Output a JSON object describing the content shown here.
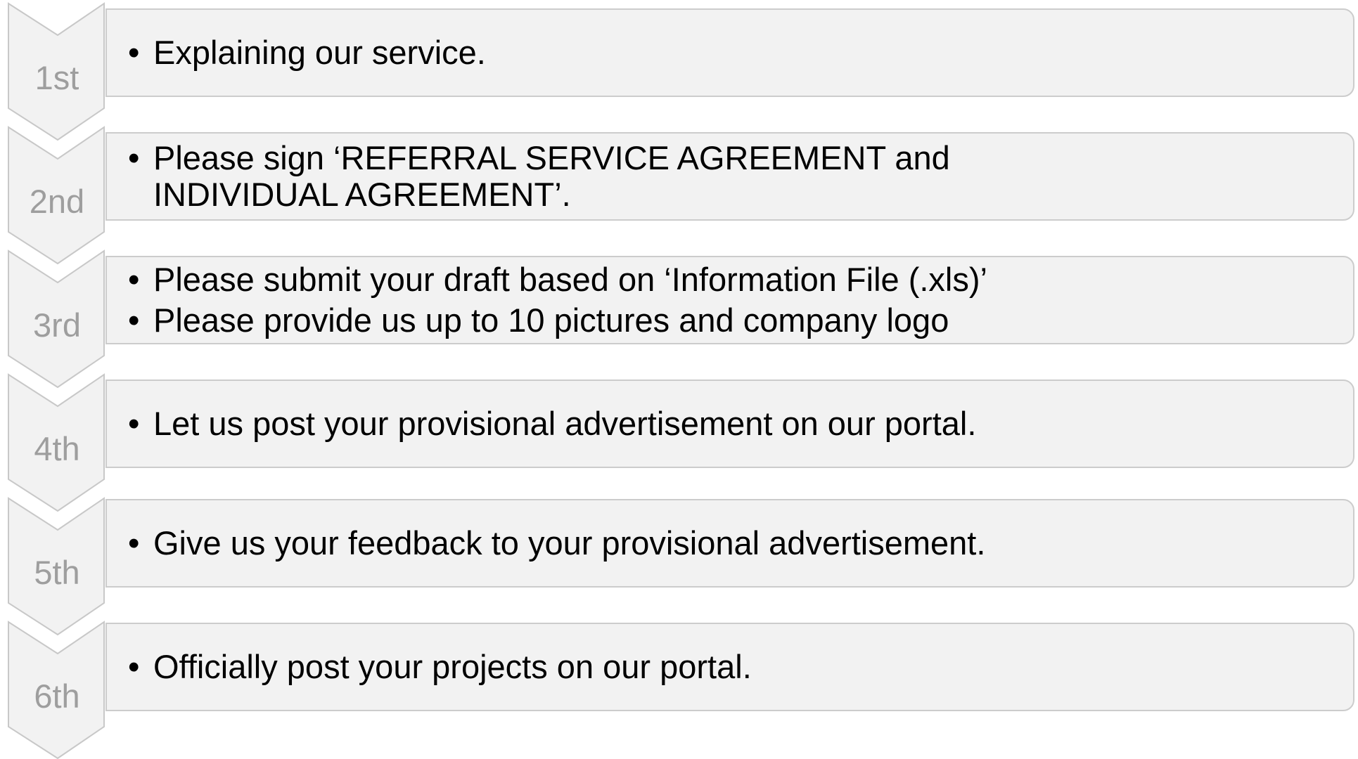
{
  "colors": {
    "chevron_fill": "#f2f2f2",
    "chevron_stroke": "#c8c8c8",
    "chevron_label": "#9e9e9e",
    "box_fill": "#f2f2f2",
    "box_border": "#cccccc",
    "text": "#000000"
  },
  "steps": [
    {
      "label": "1st",
      "bullets": [
        "Explaining our service."
      ]
    },
    {
      "label": "2nd",
      "bullets": [
        "Please sign ‘REFERRAL SERVICE AGREEMENT and INDIVIDUAL AGREEMENT’."
      ]
    },
    {
      "label": "3rd",
      "bullets": [
        "Please submit your draft based on ‘Information File (.xls)’",
        "Please provide us up to 10 pictures and company logo"
      ]
    },
    {
      "label": "4th",
      "bullets": [
        "Let us post your provisional advertisement on our portal."
      ]
    },
    {
      "label": "5th",
      "bullets": [
        "Give us your feedback to your provisional advertisement."
      ]
    },
    {
      "label": "6th",
      "bullets": [
        "Officially post your projects on our portal."
      ]
    }
  ]
}
